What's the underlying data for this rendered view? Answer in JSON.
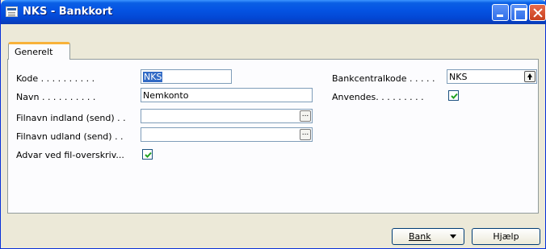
{
  "window": {
    "title": "NKS - Bankkort"
  },
  "tabs": [
    {
      "label": "Generelt",
      "active": true
    }
  ],
  "form": {
    "kode": {
      "label": "Kode . . . . . . . . . .",
      "value": "NKS"
    },
    "navn": {
      "label": "Navn . . . . . . . . . .",
      "value": "Nemkonto"
    },
    "filnavn_indland": {
      "label": "Filnavn indland (send) . .",
      "value": ""
    },
    "filnavn_udland": {
      "label": "Filnavn udland (send) . .",
      "value": ""
    },
    "advar": {
      "label": "Advar ved fil-overskriv...",
      "checked": true
    },
    "bankcentralkode": {
      "label": "Bankcentralkode . . . . .",
      "value": "NKS"
    },
    "anvendes": {
      "label": "Anvendes. . . . . . . . .",
      "checked": true
    }
  },
  "buttons": {
    "bank": "Bank",
    "help": "Hjælp"
  },
  "icons": {
    "ellipsis": "...",
    "app": "form-icon",
    "lookup": "up-arrow-icon"
  },
  "colors": {
    "titlebar": "#0554e3",
    "tab_accent": "#f8b23a",
    "selection": "#316ac5"
  }
}
